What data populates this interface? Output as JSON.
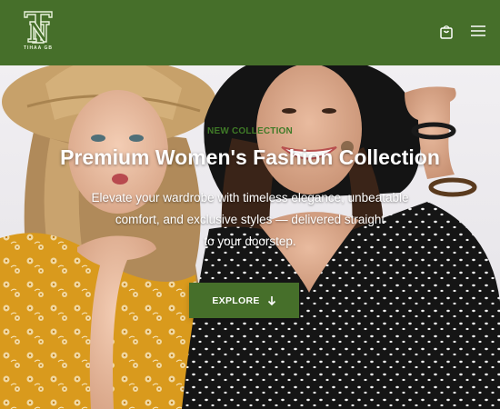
{
  "brand": {
    "logo_text": "TIHAA GB",
    "monogram": "TN"
  },
  "header": {
    "icons": [
      "shopping-bag-icon",
      "hamburger-menu-icon"
    ]
  },
  "hero": {
    "eyebrow": "NEW COLLECTION",
    "title": "Premium Women's Fashion Collection",
    "description_lines": [
      "Elevate your wardrobe with timeless elegance, unbeatable",
      "comfort, and exclusive styles — delivered straight",
      "to your doorstep."
    ],
    "cta_label": "EXPLORE",
    "cta_icon": "arrow-down-icon"
  },
  "colors": {
    "brand_green": "#466f2a",
    "eyebrow_green": "#3f7a27",
    "text_light": "#ffffff"
  }
}
